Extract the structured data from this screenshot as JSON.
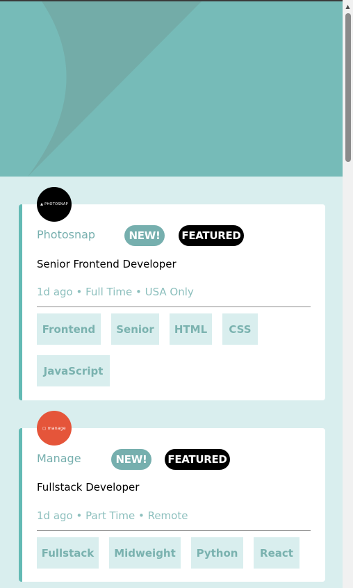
{
  "colors": {
    "hero": "#76bbb8",
    "page_background": "#d9eeee",
    "accent": "#76afae",
    "featured": "#000000",
    "manage_logo": "#e5553a"
  },
  "jobs": [
    {
      "logo_text": "▲ PHOTOSNAP",
      "company": "Photosnap",
      "new_label": "NEW!",
      "featured_label": "FEATURED",
      "position": "Senior Frontend Developer",
      "meta": "1d ago • Full Time • USA Only",
      "tags": [
        "Frontend",
        "Senior",
        "HTML",
        "CSS",
        "JavaScript"
      ]
    },
    {
      "logo_text": "◻ manage",
      "company": "Manage",
      "new_label": "NEW!",
      "featured_label": "FEATURED",
      "position": "Fullstack Developer",
      "meta": "1d ago • Part Time • Remote",
      "tags": [
        "Fullstack",
        "Midweight",
        "Python",
        "React"
      ]
    }
  ],
  "scrollbar": {
    "up_arrow_icon": "triangle-up"
  }
}
